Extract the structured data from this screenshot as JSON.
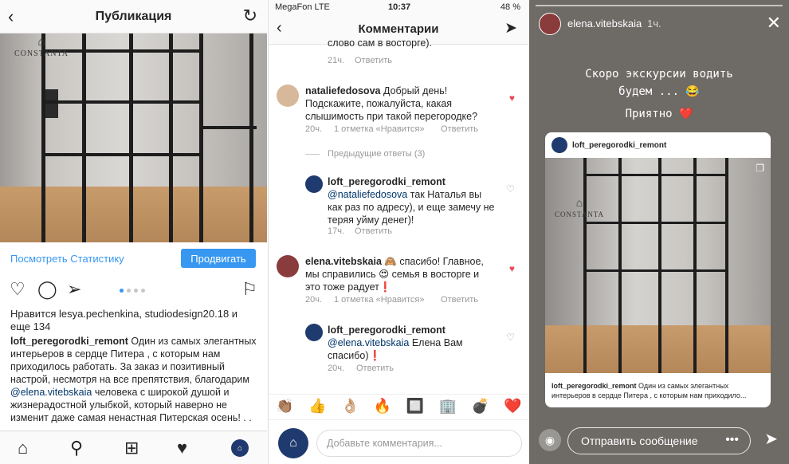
{
  "publication": {
    "title": "Публикация",
    "brand_logo": "CONSTANTA",
    "stats_link": "Посмотреть Статистику",
    "promote_button": "Продвигать",
    "likes_text": "Нравится lesya.pechenkina, studiodesign20.18 и еще 134",
    "caption_user": "loft_peregorodki_remont",
    "caption_part1": " Один из самых элегантных интерьеров в сердце Питера , с которым нам приходилось  работать. За заказ и позитивный настрой, несмотря на все препятствия,  благодарим ",
    "caption_mention": "@elena.vitebskaia",
    "caption_part2": " человека с широкой душой и жизнерадостной улыбкой, который наверно не изменит даже самая ненастная Питерская осень! . .",
    "icons": [
      "back-icon",
      "refresh-icon",
      "heart-icon",
      "comment-icon",
      "share-icon",
      "bookmark-icon",
      "home-icon",
      "search-icon",
      "add-icon",
      "activity-icon",
      "profile-icon"
    ]
  },
  "comments_screen": {
    "status_carrier": "MegaFon  LTE",
    "status_time": "10:37",
    "status_battery": "48 %",
    "title": "Комментарии",
    "top_fragment": "слово сам в восторге).",
    "top_meta_time": "21ч.",
    "top_meta_reply": "Ответить",
    "comments": [
      {
        "user": "nataliefedosova",
        "text": " Добрый день! Подскажите, пожалуйста, какая слышимость при такой перегородке?",
        "time": "20ч.",
        "likes": "1 отметка «Нравится»",
        "reply": "Ответить"
      },
      {
        "user": "loft_peregorodki_remont",
        "mention": "@nataliefedosova",
        "text": " так Наталья вы как раз по адресу), и еще замечу не теряя уйму денег)!",
        "time": "17ч.",
        "reply": "Ответить"
      },
      {
        "user": "elena.vitebskaia",
        "text": " 🙈 спасибо! Главное, мы справились 😍 семья в восторге и это тоже радует❗",
        "time": "20ч.",
        "likes": "1 отметка «Нравится»",
        "reply": "Ответить"
      },
      {
        "user": "loft_peregorodki_remont",
        "mention": "@elena.vitebskaia",
        "text": " Елена Вам спасибо)❗",
        "time": "20ч.",
        "reply": "Ответить"
      }
    ],
    "prev_replies": "Предыдущие ответы (3)",
    "emojis": [
      "👏🏽",
      "👍",
      "👌🏼",
      "🔥",
      "🔲",
      "🏢",
      "💣",
      "❤️"
    ],
    "input_placeholder": "Добавьте комментария..."
  },
  "story": {
    "user": "elena.vitebskaia",
    "time": "1ч.",
    "line1": "Скоро экскурсии водить",
    "line2": "будем ... 😂",
    "line3": "Приятно ❤️",
    "card_user": "loft_peregorodki_remont",
    "card_logo": "CONSTANTA",
    "card_caption_user": "loft_peregorodki_remont",
    "card_caption_text": " Один из самых элегантных интерьеров в сердце Питера , с которым нам приходило...",
    "send_message": "Отправить сообщение",
    "more": "•••"
  }
}
